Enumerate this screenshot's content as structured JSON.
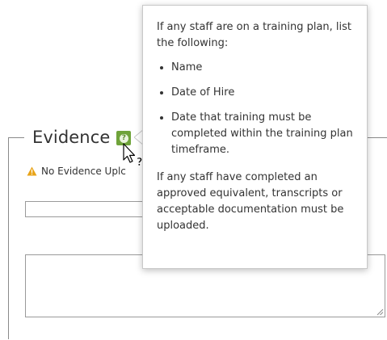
{
  "evidence": {
    "title": "Evidence",
    "help_icon": "question-icon",
    "warning_text": "No Evidence Uplc",
    "warning_icon": "warning-triangle-icon",
    "warning_color": "#e8a317",
    "badge_color": "#6fa33a"
  },
  "tooltip": {
    "intro": "If any staff are on a training plan, list the following:",
    "items": [
      "Name",
      "Date of Hire",
      "Date that training must be completed within the training plan timeframe."
    ],
    "outro": "If any staff have completed an approved equivalent, transcripts or acceptable documentation must be uploaded."
  },
  "cursor": {
    "icon": "help-pointer-cursor-icon"
  }
}
